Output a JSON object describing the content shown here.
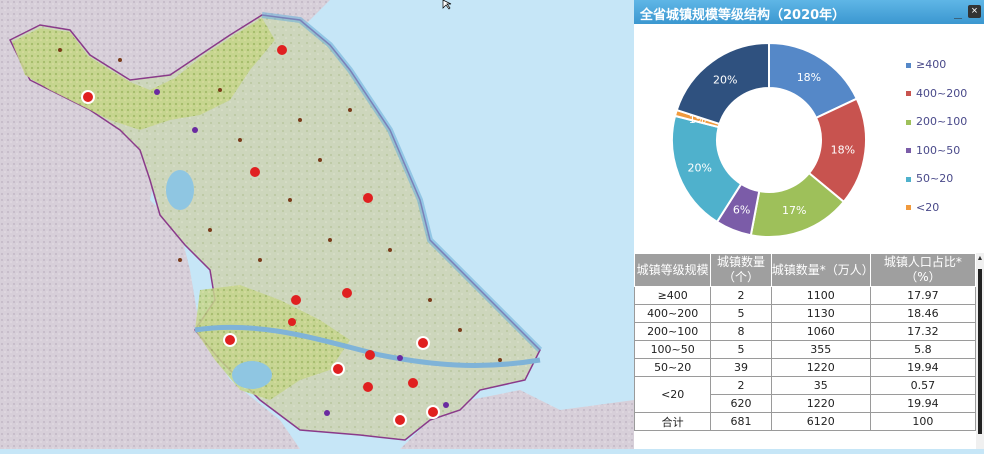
{
  "panel": {
    "title": "全省城镇规模等级结构（2020年）",
    "minimize_label": "_",
    "close_label": "×"
  },
  "chart_data": {
    "type": "pie",
    "donut": true,
    "legend_position": "right",
    "series": [
      {
        "name": "≥400",
        "value": 18,
        "label": "18%",
        "color": "#5588c8"
      },
      {
        "name": "400~200",
        "value": 18,
        "label": "18%",
        "color": "#c8534f"
      },
      {
        "name": "200~100",
        "value": 17,
        "label": "17%",
        "color": "#9ec05a"
      },
      {
        "name": "100~50",
        "value": 6,
        "label": "6%",
        "color": "#7b5ca8"
      },
      {
        "name": "50~20",
        "value": 20,
        "label": "20%",
        "color": "#4fb1cc"
      },
      {
        "name": "<20",
        "value": 1,
        "label": "1%",
        "color": "#f19a3d"
      },
      {
        "name": "",
        "value": 20,
        "label": "20%",
        "color": "#2f517f"
      }
    ]
  },
  "table": {
    "headers": [
      "城镇等级规模",
      "城镇数量（个）",
      "城镇数量*（万人）",
      "城镇人口占比*（%）"
    ],
    "rows": [
      [
        "≥400",
        "2",
        "1100",
        "17.97"
      ],
      [
        "400~200",
        "5",
        "1130",
        "18.46"
      ],
      [
        "200~100",
        "8",
        "1060",
        "17.32"
      ],
      [
        "100~50",
        "5",
        "355",
        "5.8"
      ],
      [
        "50~20",
        "39",
        "1220",
        "19.94"
      ]
    ],
    "lt20_label": "<20",
    "lt20_rows": [
      [
        "2",
        "35",
        "0.57"
      ],
      [
        "620",
        "1220",
        "19.94"
      ]
    ],
    "total": [
      "合计",
      "681",
      "6120",
      "100"
    ]
  },
  "map": {
    "sea_color": "#c6e6f7",
    "land_color": "#d9d2d8",
    "province_color": "#c9d4b0",
    "highlight_color": "#c9d88a"
  }
}
